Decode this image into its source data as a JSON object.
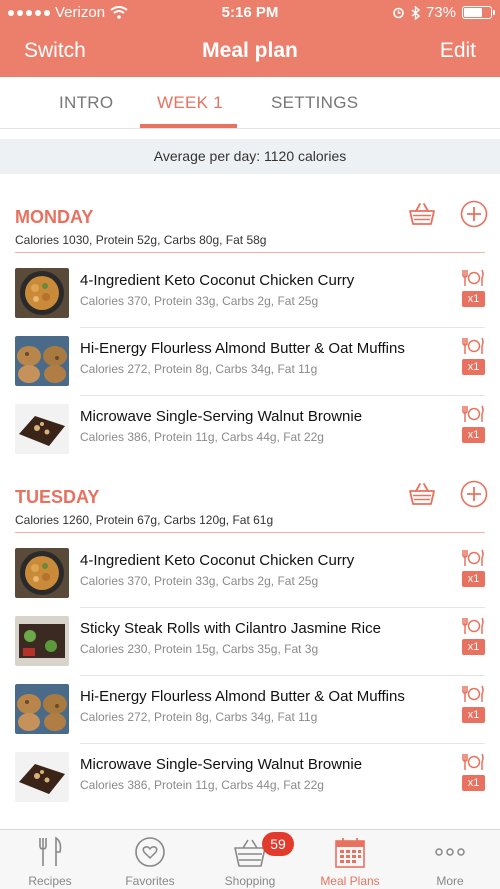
{
  "status_bar": {
    "carrier": "Verizon",
    "time": "5:16 PM",
    "battery": "73%",
    "battery_level": 0.73
  },
  "nav": {
    "left": "Switch",
    "title": "Meal plan",
    "right": "Edit"
  },
  "tabs": [
    {
      "label": "INTRO"
    },
    {
      "label": "WEEK 1"
    },
    {
      "label": "SETTINGS"
    }
  ],
  "summary": "Average per day: 1120 calories",
  "days": [
    {
      "name": "MONDAY",
      "macros": "Calories 1030, Protein 52g, Carbs 80g, Fat 58g",
      "meals": [
        {
          "name": "4-Ingredient Keto Coconut Chicken Curry",
          "macros": "Calories 370, Protein 33g, Carbs 2g, Fat 25g",
          "qty": "x1"
        },
        {
          "name": "Hi-Energy Flourless Almond Butter & Oat Muffins",
          "macros": "Calories 272, Protein 8g, Carbs 34g, Fat 11g",
          "qty": "x1"
        },
        {
          "name": "Microwave Single-Serving Walnut Brownie",
          "macros": "Calories 386, Protein 11g, Carbs 44g, Fat 22g",
          "qty": "x1"
        }
      ]
    },
    {
      "name": "TUESDAY",
      "macros": "Calories 1260, Protein 67g, Carbs 120g, Fat 61g",
      "meals": [
        {
          "name": "4-Ingredient Keto Coconut Chicken Curry",
          "macros": "Calories 370, Protein 33g, Carbs 2g, Fat 25g",
          "qty": "x1"
        },
        {
          "name": "Sticky Steak Rolls with Cilantro Jasmine Rice",
          "macros": "Calories 230, Protein 15g, Carbs 35g, Fat 3g",
          "qty": "x1"
        },
        {
          "name": "Hi-Energy Flourless Almond Butter & Oat Muffins",
          "macros": "Calories 272, Protein 8g, Carbs 34g, Fat 11g",
          "qty": "x1"
        },
        {
          "name": "Microwave Single-Serving Walnut Brownie",
          "macros": "Calories 386, Protein 11g, Carbs 44g, Fat 22g",
          "qty": "x1"
        }
      ]
    }
  ],
  "tabbar": {
    "items": [
      {
        "label": "Recipes",
        "icon": "fork-knife-icon"
      },
      {
        "label": "Favorites",
        "icon": "heart-icon"
      },
      {
        "label": "Shopping",
        "icon": "basket-icon"
      },
      {
        "label": "Meal Plans",
        "icon": "calendar-icon"
      },
      {
        "label": "More",
        "icon": "ellipsis-icon"
      }
    ],
    "shopping_badge": "59",
    "active": "Meal Plans"
  },
  "colors": {
    "accent": "#e8725f",
    "header": "#ec7f6c",
    "badge": "#e23a2c"
  }
}
